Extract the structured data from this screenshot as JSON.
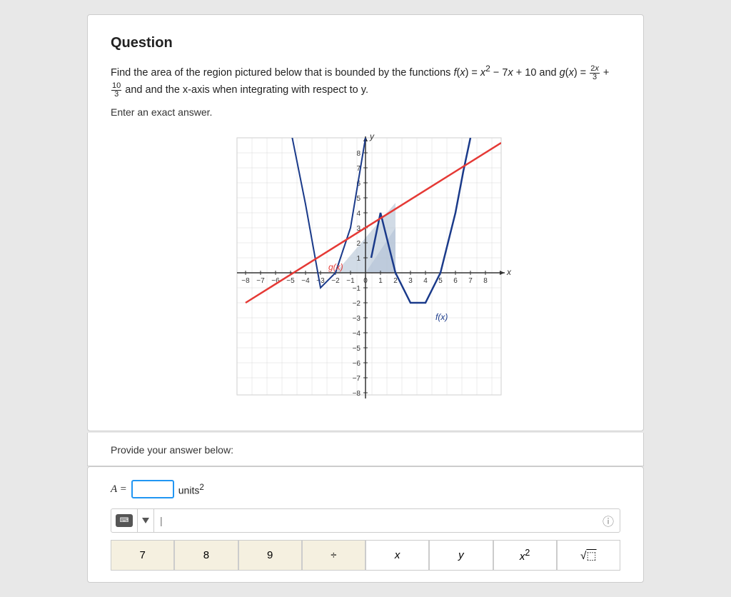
{
  "page": {
    "title": "Question",
    "question_intro": "Find the area of the region pictured below that is bounded by the functions",
    "question_end": "and the x-axis when integrating with respect to y.",
    "exact_answer_label": "Enter an exact answer.",
    "provide_answer_label": "Provide your answer below:",
    "answer_label": "A =",
    "units_label": "units²",
    "and_text": "and"
  },
  "functions": {
    "f": "f(x) = x² − 7x + 10",
    "g": "g(x) = 2x/3 + 10/3",
    "f_label": "f(x)",
    "g_label": "g(x)"
  },
  "calculator": {
    "buttons": [
      {
        "label": "7",
        "type": "number"
      },
      {
        "label": "8",
        "type": "number"
      },
      {
        "label": "9",
        "type": "number"
      },
      {
        "label": "÷",
        "type": "operator"
      },
      {
        "label": "x",
        "type": "var"
      },
      {
        "label": "y",
        "type": "var"
      },
      {
        "label": "x²",
        "type": "func"
      },
      {
        "label": "√☐",
        "type": "func"
      }
    ]
  },
  "colors": {
    "blue_curve": "#1a3a8a",
    "red_line": "#e53935",
    "shaded": "#b0bcd4",
    "grid": "#d0d0d0",
    "axis": "#333"
  }
}
